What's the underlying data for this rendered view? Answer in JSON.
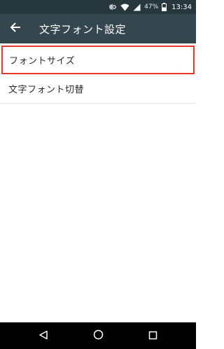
{
  "status_bar": {
    "battery_percent": "47%",
    "time": "13:34",
    "icons": [
      "nfc-icon",
      "wifi-icon",
      "signal-icon",
      "battery-icon"
    ]
  },
  "app_bar": {
    "back_icon": "arrow-left-icon",
    "title": "文字フォント設定"
  },
  "list": {
    "items": [
      {
        "label": "フォントサイズ",
        "highlighted": true
      },
      {
        "label": "文字フォント切替",
        "highlighted": false
      }
    ]
  },
  "nav_bar": {
    "buttons": [
      "back-triangle-icon",
      "home-circle-icon",
      "recents-square-icon"
    ]
  },
  "colors": {
    "status_bar": "#27373e",
    "app_bar": "#34474f",
    "highlight_border": "#e8382a",
    "nav_bar": "#000000"
  }
}
